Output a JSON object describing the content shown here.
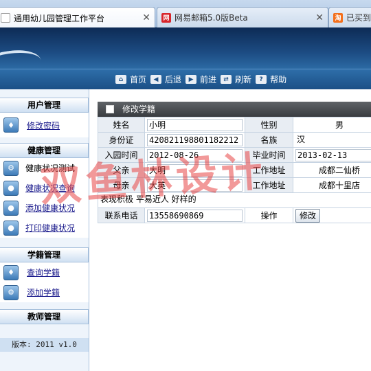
{
  "browser": {
    "tabs": [
      {
        "title": "通用幼儿园管理工作平台",
        "icon": "page-icon"
      },
      {
        "title": "网易邮箱5.0版Beta",
        "icon": "netease-mail-icon"
      },
      {
        "title": "已买到的",
        "icon": "taobao-icon"
      }
    ]
  },
  "nav": {
    "items": [
      {
        "label": "首页",
        "icon": "home-icon"
      },
      {
        "label": "后退",
        "icon": "back-arrow-icon"
      },
      {
        "label": "前进",
        "icon": "forward-arrow-icon"
      },
      {
        "label": "刷新",
        "icon": "refresh-icon"
      },
      {
        "label": "帮助",
        "icon": "help-icon"
      }
    ]
  },
  "sidebar": {
    "groups": [
      {
        "title": "用户管理",
        "items": [
          {
            "label": "修改密码",
            "link": true
          }
        ]
      },
      {
        "title": "健康管理",
        "items": [
          {
            "label": "健康状况测试",
            "link": false
          },
          {
            "label": "健康状况查询",
            "link": true
          },
          {
            "label": "添加健康状况",
            "link": true
          },
          {
            "label": "打印健康状况",
            "link": true
          }
        ]
      },
      {
        "title": "学籍管理",
        "items": [
          {
            "label": "查询学籍",
            "link": true
          },
          {
            "label": "添加学籍",
            "link": true
          }
        ]
      },
      {
        "title": "教师管理",
        "items": []
      }
    ],
    "version": "版本: 2011 v1.0"
  },
  "panel": {
    "title": "修改学籍",
    "fields": {
      "name_label": "姓名",
      "name": "小明",
      "gender_label": "性别",
      "gender": "男",
      "id_label": "身份证",
      "id": "420821198801182212",
      "ethnicity_label": "名族",
      "ethnicity": "汉",
      "enroll_label": "入园时间",
      "enroll": "2012-08-26",
      "grad_label": "毕业时间",
      "grad": "2013-02-13",
      "father_label": "父亲",
      "father": "大明",
      "father_work_label": "工作地址",
      "father_work": "成都二仙桥",
      "mother_label": "母亲",
      "mother": "大英",
      "mother_work_label": "工作地址",
      "mother_work": "成都十里店",
      "remark": "表现积极 平易近人 好样的",
      "phone_label": "联系电话",
      "phone": "13558690869",
      "action_label": "操作",
      "modify_button": "修改"
    }
  },
  "watermark": "双鱼林设计",
  "colors": {
    "banner": "#1c4b82",
    "sidebar_bg": "#eef4fb",
    "panel_title": "#4a4d51",
    "watermark": "#e84646"
  }
}
